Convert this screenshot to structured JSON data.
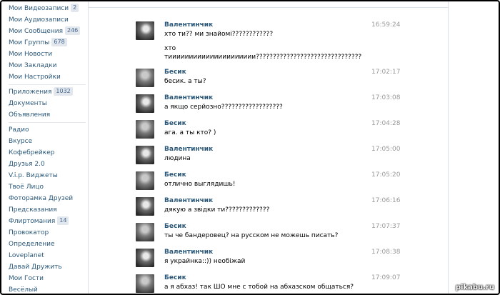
{
  "sidebar": {
    "group1": [
      {
        "label": "Мои Видеозаписи",
        "count": "2"
      },
      {
        "label": "Мои Аудиозаписи",
        "count": ""
      },
      {
        "label": "Мои Сообщения",
        "count": "246"
      },
      {
        "label": "Мои Группы",
        "count": "678"
      },
      {
        "label": "Мои Новости",
        "count": ""
      },
      {
        "label": "Мои Закладки",
        "count": ""
      },
      {
        "label": "Мои Настройки",
        "count": ""
      }
    ],
    "group2": [
      {
        "label": "Приложения",
        "count": "1032"
      },
      {
        "label": "Документы",
        "count": ""
      },
      {
        "label": "Объявления",
        "count": ""
      }
    ],
    "group3": [
      {
        "label": "Радио",
        "count": ""
      },
      {
        "label": "Вкурсе",
        "count": ""
      },
      {
        "label": "Кофебрейкер",
        "count": ""
      },
      {
        "label": "Друзья 2.0",
        "count": ""
      },
      {
        "label": "V.i.p. Виджеты",
        "count": ""
      },
      {
        "label": "Твоё Лицо",
        "count": ""
      },
      {
        "label": "Фоторамка Друзей",
        "count": ""
      },
      {
        "label": "Предсказания",
        "count": ""
      },
      {
        "label": "Флиртомания",
        "count": "14"
      },
      {
        "label": "Провокатор",
        "count": ""
      },
      {
        "label": "Определение",
        "count": ""
      },
      {
        "label": "Loveplanet",
        "count": ""
      },
      {
        "label": "Давай Дружить",
        "count": ""
      },
      {
        "label": "Мои Гости",
        "count": ""
      },
      {
        "label": "Весёлый",
        "count": ""
      }
    ]
  },
  "messages": [
    {
      "author": "Валентинчик",
      "avatar": "valentin",
      "time": "16:59:24",
      "text": "хто ти?? ми знайомі????????????",
      "extra1": "хто",
      "extra2": "тиииииииииииииииииииии???????????????????????????????"
    },
    {
      "author": "Бесик",
      "avatar": "besik",
      "time": "17:02:17",
      "text": "бесик. а ты?"
    },
    {
      "author": "Валентинчик",
      "avatar": "valentin",
      "time": "17:03:08",
      "text": "а якщо серйозно??????????????????"
    },
    {
      "author": "Бесик",
      "avatar": "besik",
      "time": "17:04:28",
      "text": "ага. а ты кто? )"
    },
    {
      "author": "Валентинчик",
      "avatar": "valentin",
      "time": "17:05:00",
      "text": "людина"
    },
    {
      "author": "Бесик",
      "avatar": "besik",
      "time": "17:05:20",
      "text": "отлично выглядишь!"
    },
    {
      "author": "Валентинчик",
      "avatar": "valentin",
      "time": "17:06:16",
      "text": "дякую а звідки ти?????????????"
    },
    {
      "author": "Бесик",
      "avatar": "besik",
      "time": "17:07:37",
      "text": "ты че бандеровец? на русском не можешь писать?"
    },
    {
      "author": "Валентинчик",
      "avatar": "valentin",
      "time": "17:08:38",
      "text": "я украйнка::)) необіжай"
    },
    {
      "author": "Бесик",
      "avatar": "besik",
      "time": "17:09:07",
      "text": "а я абхаз! так ШО мне с тобой на абхазском общаться?"
    }
  ],
  "watermark": "pikabu.ru",
  "colors": {
    "link": "#2b587a",
    "time": "#999999",
    "badge_bg": "#e1e7ed",
    "border": "#dae1e8"
  }
}
